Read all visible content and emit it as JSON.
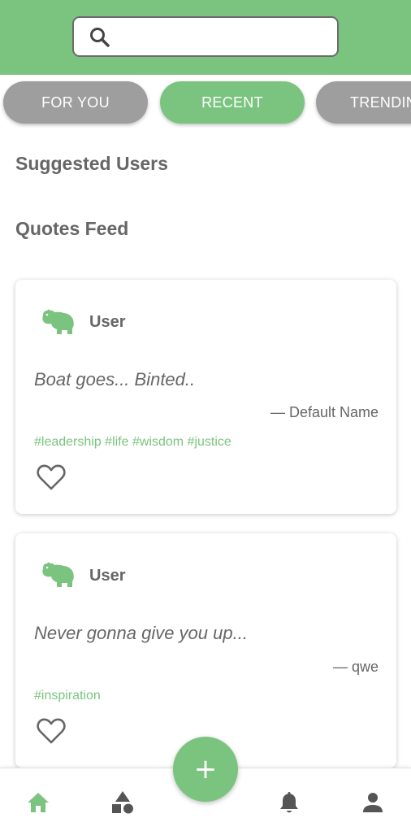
{
  "search": {
    "placeholder": "",
    "value": ""
  },
  "tabs": [
    {
      "label": "FOR YOU",
      "active": false
    },
    {
      "label": "RECENT",
      "active": true
    },
    {
      "label": "TRENDING",
      "active": false
    }
  ],
  "sections": {
    "suggested_users": "Suggested Users",
    "quotes_feed": "Quotes Feed"
  },
  "posts": [
    {
      "avatar_icon": "hippo-icon",
      "user": "User",
      "quote": "Boat goes... Binted..",
      "author": "— Default Name",
      "tags": "#leadership #life #wisdom #justice",
      "liked": false
    },
    {
      "avatar_icon": "hippo-icon",
      "user": "User",
      "quote": "Never gonna give you up...",
      "author": "— qwe",
      "tags": "#inspiration",
      "liked": false
    }
  ],
  "fab": {
    "label": "+"
  },
  "nav": [
    {
      "icon": "home-icon",
      "active": true
    },
    {
      "icon": "categories-icon",
      "active": false
    },
    {
      "icon": "bell-icon",
      "active": false
    },
    {
      "icon": "profile-icon",
      "active": false
    }
  ],
  "colors": {
    "accent": "#7bc47f",
    "inactive_tab": "#9e9e9e",
    "icon_grey": "#555555",
    "text": "#666666"
  }
}
